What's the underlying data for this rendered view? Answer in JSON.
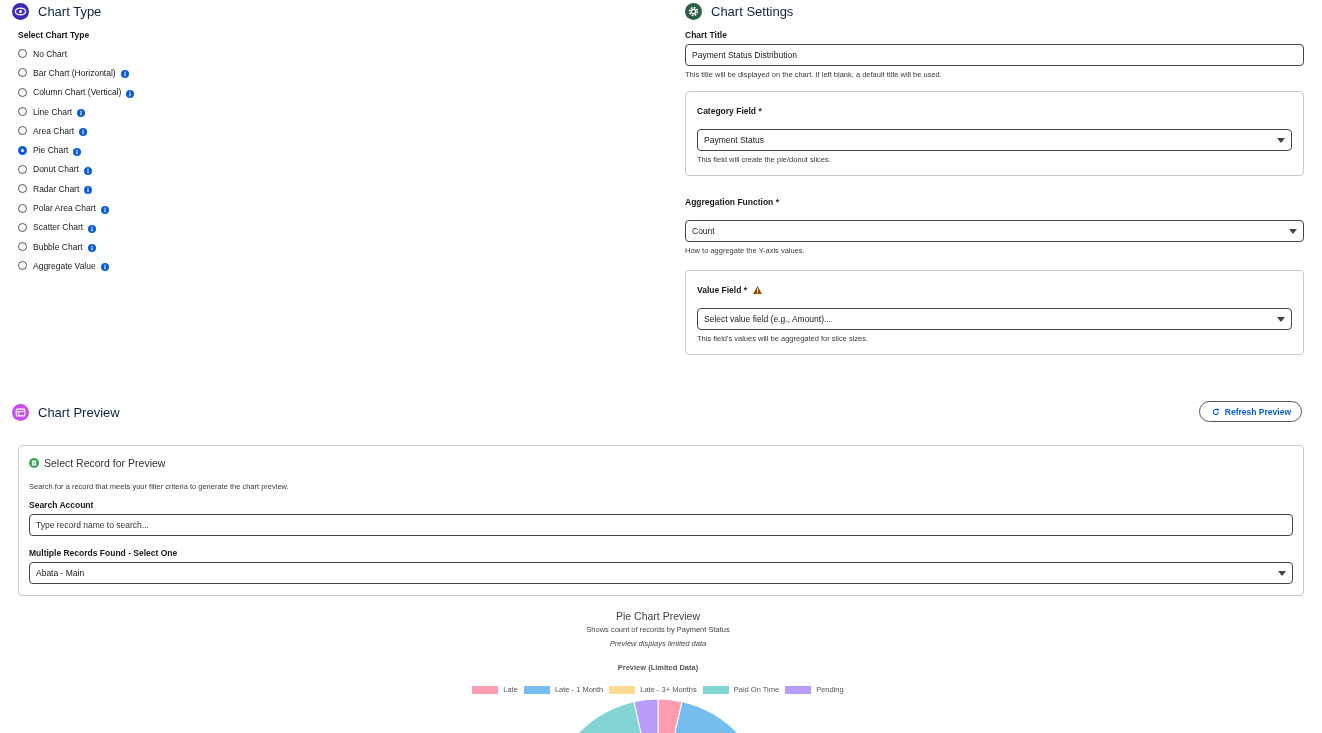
{
  "chart_type": {
    "title": "Chart Type",
    "label": "Select Chart Type",
    "options": [
      {
        "label": "No Chart",
        "selected": false,
        "info": false
      },
      {
        "label": "Bar Chart (Horizontal)",
        "selected": false,
        "info": true
      },
      {
        "label": "Column Chart (Vertical)",
        "selected": false,
        "info": true
      },
      {
        "label": "Line Chart",
        "selected": false,
        "info": true
      },
      {
        "label": "Area Chart",
        "selected": false,
        "info": true
      },
      {
        "label": "Pie Chart",
        "selected": true,
        "info": true
      },
      {
        "label": "Donut Chart",
        "selected": false,
        "info": true
      },
      {
        "label": "Radar Chart",
        "selected": false,
        "info": true
      },
      {
        "label": "Polar Area Chart",
        "selected": false,
        "info": true
      },
      {
        "label": "Scatter Chart",
        "selected": false,
        "info": true
      },
      {
        "label": "Bubble Chart",
        "selected": false,
        "info": true
      },
      {
        "label": "Aggregate Value",
        "selected": false,
        "info": true
      }
    ]
  },
  "chart_settings": {
    "title": "Chart Settings",
    "chart_title": {
      "label": "Chart Title",
      "value": "Payment Status Distribution",
      "help": "This title will be displayed on the chart. If left blank, a default title will be used."
    },
    "category_field": {
      "label": "Category Field *",
      "value": "Payment Status",
      "help": "This field will create the pie/donut slices."
    },
    "aggregation": {
      "label": "Aggregation Function *",
      "value": "Count",
      "help": "How to aggregate the Y-axis values."
    },
    "value_field": {
      "label": "Value Field *",
      "warning": true,
      "placeholder": "Select value field (e.g., Amount)...",
      "help": "This field's values will be aggregated for slice sizes."
    }
  },
  "preview": {
    "title": "Chart Preview",
    "refresh_button": "Refresh Preview",
    "record_card": {
      "title": "Select Record for Preview",
      "description": "Search for a record that meets your filter criteria to generate the chart preview.",
      "search": {
        "label": "Search Account",
        "placeholder": "Type record name to search..."
      },
      "records": {
        "label": "Multiple Records Found - Select One",
        "value": "Abata - Main"
      }
    },
    "chart": {
      "title": "Pie Chart Preview",
      "subtitle": "Shows count of records by Payment Status",
      "note": "Preview displays limited data",
      "chart_title": "Preview (Limited Data)",
      "legend": [
        {
          "label": "Late",
          "color": "#ff9db0"
        },
        {
          "label": "Late - 1 Month",
          "color": "#74bdee"
        },
        {
          "label": "Late - 3+ Months",
          "color": "#ffdc94"
        },
        {
          "label": "Paid On Time",
          "color": "#83d5d3"
        },
        {
          "label": "Pending",
          "color": "#b99cf7"
        }
      ]
    }
  }
}
